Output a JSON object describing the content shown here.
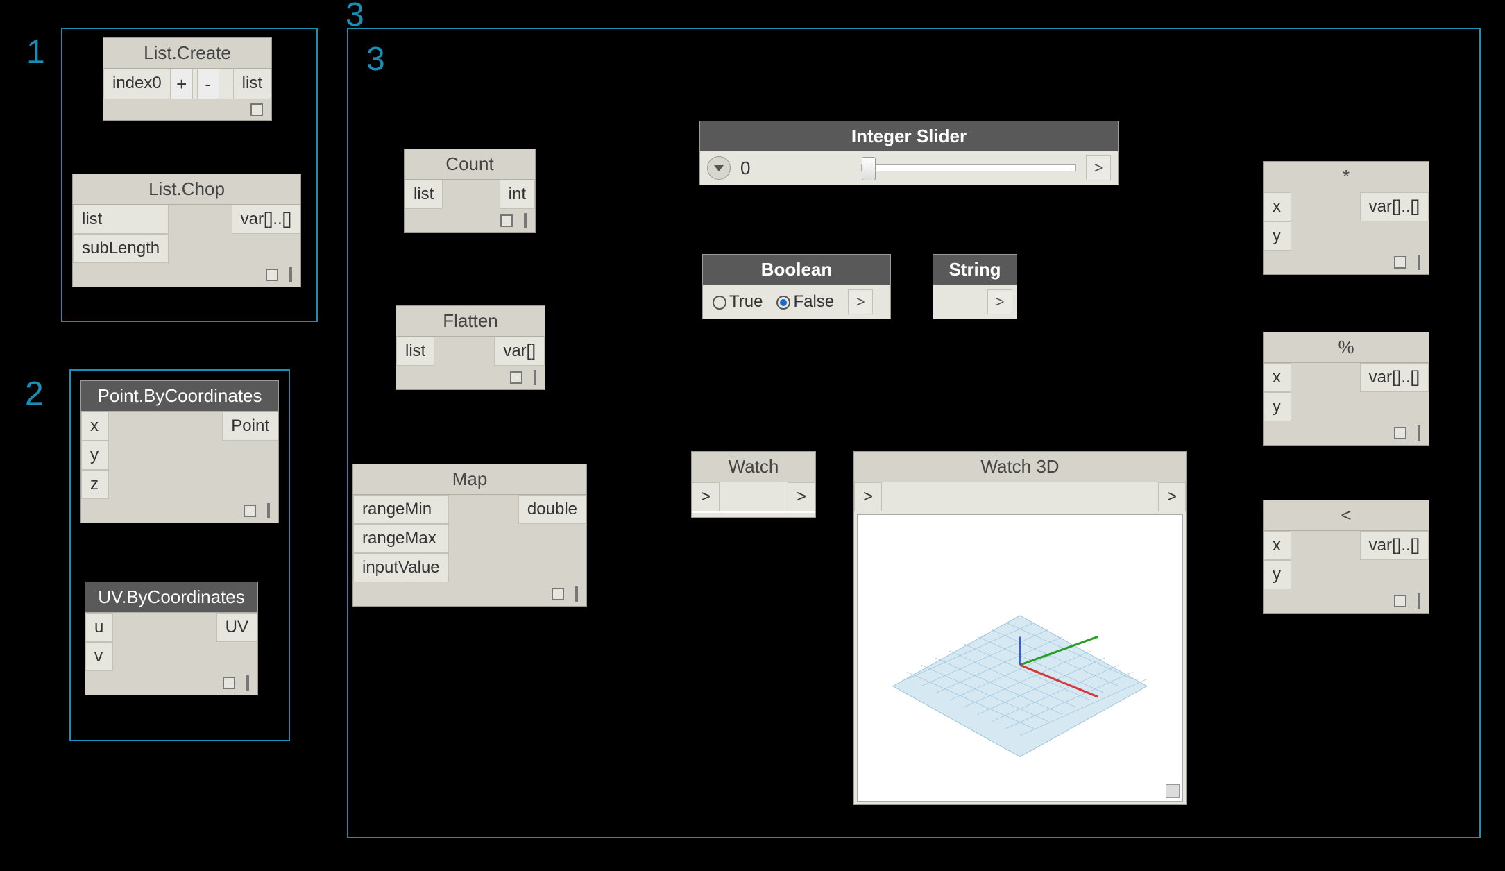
{
  "groups": {
    "g1": {
      "num": "1"
    },
    "g2": {
      "num": "2"
    },
    "g3_small": {
      "num": "3"
    },
    "g3_big": {
      "num": "3"
    }
  },
  "nodes": {
    "list_create": {
      "title": "List.Create",
      "in": "index0",
      "plus": "+",
      "minus": "-",
      "out": "list"
    },
    "list_chop": {
      "title": "List.Chop",
      "in1": "list",
      "in2": "subLength",
      "out": "var[]..[]"
    },
    "point_bc": {
      "title": "Point.ByCoordinates",
      "in1": "x",
      "in2": "y",
      "in3": "z",
      "out": "Point"
    },
    "uv_bc": {
      "title": "UV.ByCoordinates",
      "in1": "u",
      "in2": "v",
      "out": "UV"
    },
    "count": {
      "title": "Count",
      "in": "list",
      "out": "int"
    },
    "flatten": {
      "title": "Flatten",
      "in": "list",
      "out": "var[]"
    },
    "map": {
      "title": "Map",
      "in1": "rangeMin",
      "in2": "rangeMax",
      "in3": "inputValue",
      "out": "double"
    },
    "int_slider": {
      "title": "Integer Slider",
      "value": "0",
      "out": ">"
    },
    "boolean": {
      "title": "Boolean",
      "true": "True",
      "false": "False",
      "out": ">"
    },
    "string": {
      "title": "String",
      "out": ">"
    },
    "watch": {
      "title": "Watch",
      "in": ">",
      "out": ">"
    },
    "watch3d": {
      "title": "Watch 3D",
      "in": ">",
      "out": ">"
    },
    "mul": {
      "title": "*",
      "in1": "x",
      "in2": "y",
      "out": "var[]..[]"
    },
    "mod": {
      "title": "%",
      "in1": "x",
      "in2": "y",
      "out": "var[]..[]"
    },
    "lt": {
      "title": "<",
      "in1": "x",
      "in2": "y",
      "out": "var[]..[]"
    }
  }
}
